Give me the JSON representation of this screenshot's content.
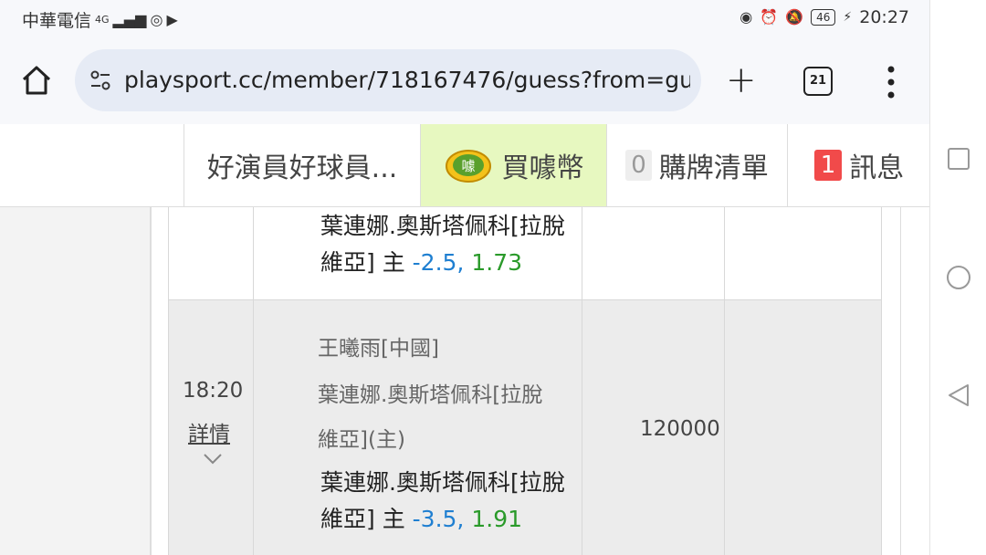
{
  "status_bar": {
    "carrier": "中華電信",
    "network": "4G",
    "battery": "46",
    "time": "20:27"
  },
  "browser": {
    "url": "playsport.cc/member/718167476/guess?from=gue",
    "tab_count": "21"
  },
  "nav": {
    "profile_label": "好演員好球員...",
    "coin_label": "買噱幣",
    "coin_icon_text": "噱",
    "cart_count": "0",
    "cart_label": "購牌清單",
    "msg_count": "1",
    "msg_label": "訊息"
  },
  "rows": [
    {
      "pick_line1": "葉連娜.奧斯塔佩科[拉脫",
      "pick_line2_prefix": "維亞] 主",
      "pick_line": "-2.5,",
      "pick_odds": "1.73"
    },
    {
      "time": "18:20",
      "detail_label": "詳情",
      "away_team": "王曦雨[中國]",
      "home_team_line1": "葉連娜.奧斯塔佩科[拉脫",
      "home_team_line2": "維亞](主)",
      "pick_line1": "葉連娜.奧斯塔佩科[拉脫",
      "pick_line2_prefix": "維亞] 主",
      "pick_line": "-3.5,",
      "pick_odds": "1.91",
      "amount": "120000"
    }
  ],
  "colors": {
    "coin_bg": "#e7f8c0",
    "msg_badge": "#f14a4a",
    "line_blue": "#1f7fd1",
    "odds_green": "#2a9a2a"
  }
}
